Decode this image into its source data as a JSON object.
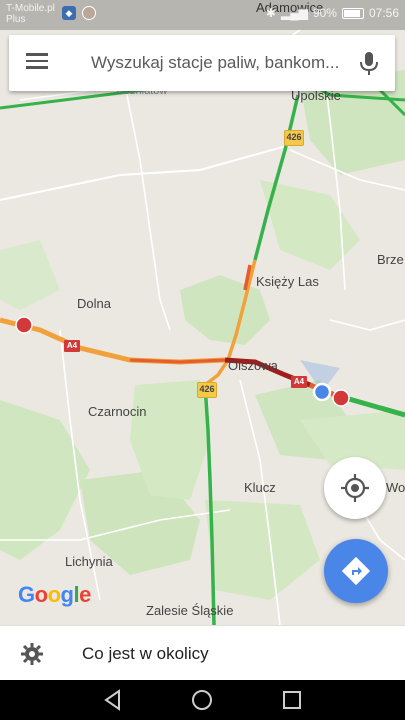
{
  "status_bar": {
    "carrier_line1": "T-Mobile.pl",
    "carrier_line2": "Plus",
    "battery": "90%",
    "time": "07:56"
  },
  "search": {
    "placeholder": "Wyszukaj stacje paliw, bankom..."
  },
  "map": {
    "places": {
      "adamowice": "Adamowice",
      "upolskie": "Upolskie",
      "rozniatow": "Rozniatów",
      "ksiezy_las": "Księży Las",
      "brze": "Brze",
      "dolna": "Dolna",
      "olszowa": "Olszowa",
      "czarnocin": "Czarnocin",
      "klucz": "Klucz",
      "wod": "Wod",
      "lichynia": "Lichynia",
      "zalesie": "Zalesie Śląskie"
    },
    "road_shields": {
      "r426_top": "426",
      "r426_mid": "426",
      "a4_left": "A4",
      "a4_right": "A4"
    },
    "traffic_colors": {
      "heavy": "#a11d1d",
      "slow": "#e35d2e",
      "moderate": "#f2a03a",
      "free": "#36b24a"
    }
  },
  "brand": "Google",
  "bottom": {
    "explore_label": "Co jest w okolicy"
  },
  "icons": {
    "menu": "menu-icon",
    "mic": "mic-icon",
    "location": "my-location-icon",
    "directions": "directions-icon",
    "explore": "gear-icon",
    "back": "back-icon",
    "home": "home-icon",
    "recents": "recents-icon"
  }
}
